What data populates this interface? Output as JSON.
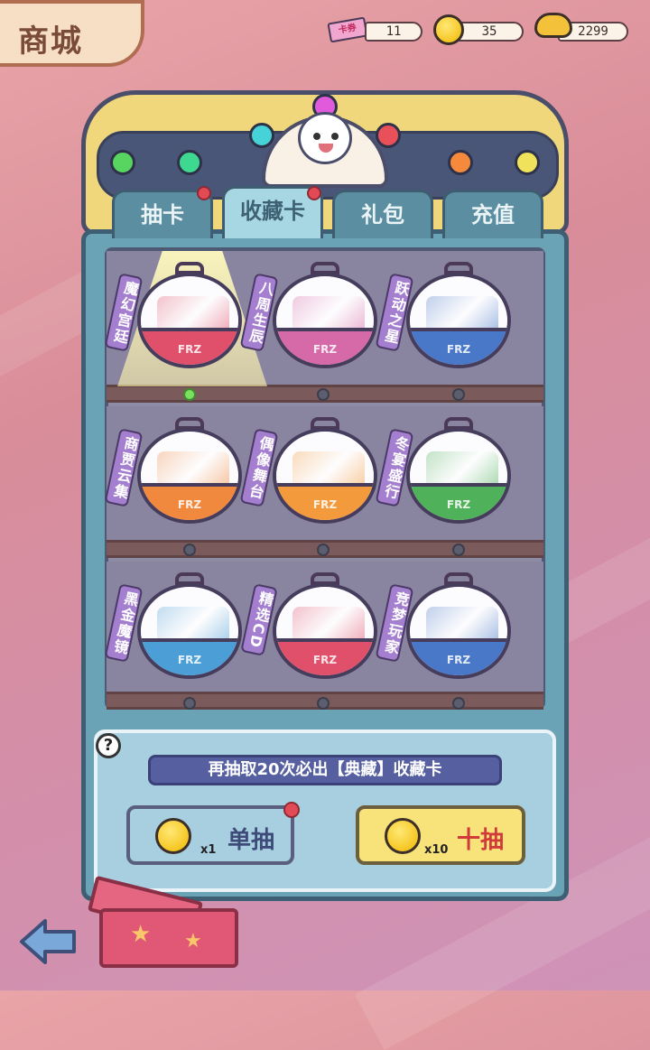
{
  "header": {
    "title": "商城"
  },
  "currencies": [
    {
      "icon": "ticket-icon",
      "tag": "卡券",
      "value": "11"
    },
    {
      "icon": "gold-coin-icon",
      "value": "35"
    },
    {
      "icon": "gold-ingot-icon",
      "value": "2299"
    }
  ],
  "tabs": [
    {
      "label": "抽卡",
      "has_dot": true
    },
    {
      "label": "收藏卡",
      "active": true,
      "has_dot": true
    },
    {
      "label": "礼包",
      "has_dot": false
    },
    {
      "label": "充值",
      "has_dot": false
    }
  ],
  "shelves": [
    [
      {
        "label": "魔幻宫廷",
        "brand": "FRZ",
        "color": "#e0506b",
        "selected": true
      },
      {
        "label": "八周生辰",
        "brand": "FRZ",
        "color": "#d66aa8",
        "selected": false
      },
      {
        "label": "跃动之星",
        "brand": "FRZ",
        "color": "#4a78c9",
        "selected": false
      }
    ],
    [
      {
        "label": "商贾云集",
        "brand": "FRZ",
        "color": "#f0883e",
        "selected": false
      },
      {
        "label": "偶像舞台",
        "brand": "FRZ",
        "color": "#f39a3c",
        "selected": false
      },
      {
        "label": "冬宴盛行",
        "brand": "FRZ",
        "color": "#4fb25a",
        "selected": false
      }
    ],
    [
      {
        "label": "黑金魔镜",
        "brand": "FRZ",
        "color": "#4b9fd6",
        "selected": false
      },
      {
        "label": "精选CD",
        "brand": "FRZ",
        "color": "#e0506b",
        "selected": false
      },
      {
        "label": "竞梦玩家",
        "brand": "FRZ",
        "color": "#4a78c9",
        "selected": false
      }
    ]
  ],
  "panel": {
    "help": "?",
    "hint": "再抽取20次必出【典藏】收藏卡",
    "single": {
      "mult": "x1",
      "label": "单抽"
    },
    "ten": {
      "mult": "x10",
      "label": "十抽"
    }
  },
  "colors": {
    "accent_red": "#e24a55",
    "ten_label": "#d13a3a",
    "single_label": "#3e4a78"
  }
}
